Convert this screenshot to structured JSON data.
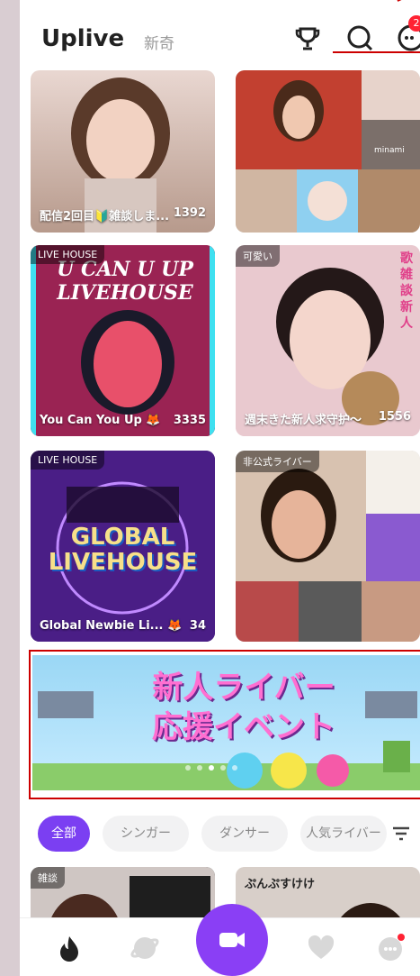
{
  "header": {
    "app_name": "Uplive",
    "subtitle": "新奇",
    "notif_count": "2"
  },
  "cards": [
    {
      "caption": "配信2回目🔰雑談しま...",
      "count": "1392",
      "tag": ""
    },
    {
      "caption": "",
      "count": "",
      "tag": "",
      "overlay_text": "minami"
    },
    {
      "caption": "You Can You Up 🦊",
      "count": "3335",
      "tag": "LIVE HOUSE",
      "art_text": "U CAN U UP LIVEHOUSE"
    },
    {
      "caption": "週末きた新人求守护〜",
      "count": "1556",
      "tag": "可愛い",
      "side_text": "歌 雑談 新人"
    },
    {
      "caption": "Global Newbie Li... 🦊",
      "count": "34",
      "tag": "LIVE HOUSE",
      "art_text": "GLOBAL LIVEHOUSE"
    },
    {
      "caption": "",
      "count": "",
      "tag": "非公式ライバー"
    }
  ],
  "banner": {
    "line1": "新人ライバー",
    "line2": "応援イベント"
  },
  "chips": [
    "全部",
    "シンガー",
    "ダンサー",
    "人気ライバー"
  ],
  "bottom_cards": [
    {
      "tag": "雑談"
    },
    {
      "tag": "",
      "text": "ぷんぷすけけ"
    }
  ],
  "nav": [
    "home-icon",
    "explore-icon",
    "live-camera-icon",
    "heart-icon",
    "messages-icon"
  ]
}
